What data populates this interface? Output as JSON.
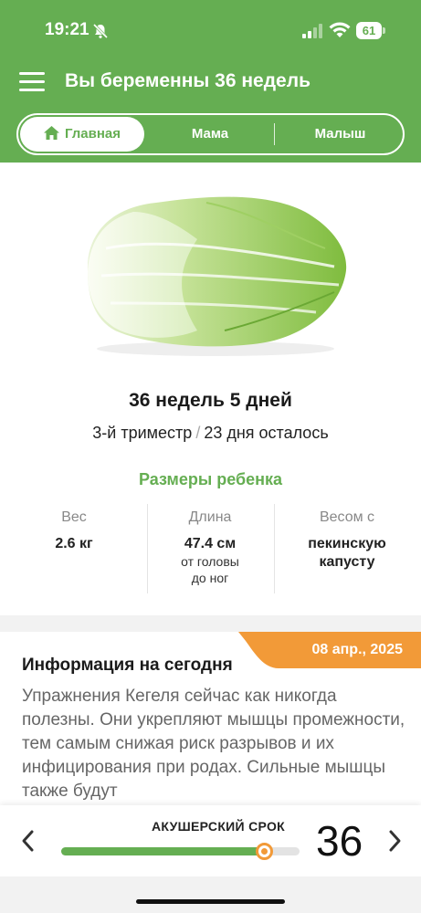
{
  "status_bar": {
    "time": "19:21",
    "battery": "61",
    "icons": [
      "bell-off-icon",
      "signal-icon",
      "wifi-icon",
      "battery-icon"
    ]
  },
  "header": {
    "title": "Вы беременны 36 недель",
    "menu_icon": "hamburger-menu-icon"
  },
  "tabs": {
    "home": "Главная",
    "mama": "Мама",
    "baby": "Малыш",
    "home_icon": "home-icon"
  },
  "pregnancy": {
    "weeks_days": "36 недель 5 дней",
    "trimester": "3-й триместр",
    "separator": "/",
    "remaining": "23 дня осталось"
  },
  "baby_size": {
    "title": "Размеры ребенка",
    "weight_label": "Вес",
    "weight_value": "2.6 кг",
    "length_label": "Длина",
    "length_value": "47.4 см",
    "length_note_1": "от головы",
    "length_note_2": "до ног",
    "compare_label": "Весом с",
    "compare_value_1": "пекинскую",
    "compare_value_2": "капусту",
    "image": "napa-cabbage-illustration"
  },
  "info": {
    "title": "Информация на сегодня",
    "date": "08 апр., 2025",
    "body": "Упражнения Кегеля сейчас как никогда полезны. Они укрепляют мышцы промежности, тем самым снижая риск разрывов и их инфицирования при родах. Сильные мышцы также будут"
  },
  "term_selector": {
    "label": "АКУШЕРСКИЙ СРОК",
    "week": "36",
    "progress": 0.85,
    "prev_icon": "chevron-left-icon",
    "next_icon": "chevron-right-icon"
  },
  "colors": {
    "primary_green": "#65ae52",
    "accent_orange": "#f29a38",
    "background": "#f2f2f2",
    "card": "#ffffff"
  }
}
